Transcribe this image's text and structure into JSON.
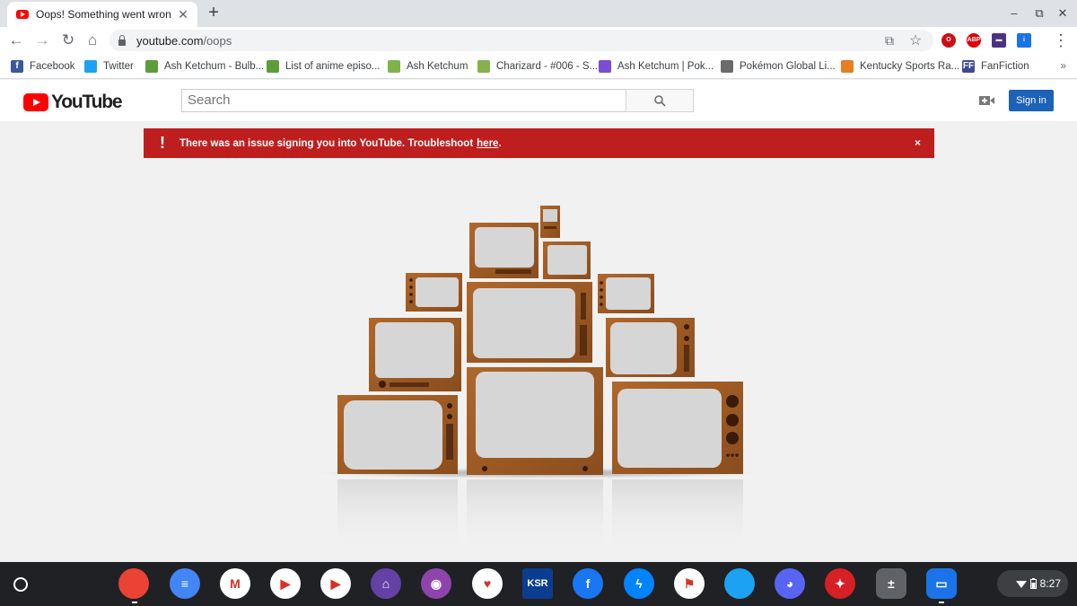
{
  "browser": {
    "tab": {
      "title": "Oops! Something went wrong. - YouTube",
      "close_glyph": "✕"
    },
    "new_tab_glyph": "+",
    "window_controls": {
      "minimize": "–",
      "restore": "⧉",
      "close": "✕"
    },
    "nav": {
      "back": "←",
      "forward": "→",
      "reload": "↻",
      "home": "⌂"
    },
    "address": {
      "host": "youtube.com",
      "path": "/oops"
    },
    "omnibox_icons": {
      "share": "⧉",
      "star": "☆"
    },
    "extensions": [
      {
        "name": "opera-icon",
        "label": "O",
        "color": "#cc0f16"
      },
      {
        "name": "adblock-icon",
        "label": "ABP",
        "color": "#e40000"
      },
      {
        "name": "twitch-ext-icon",
        "label": "▬",
        "color": "#4b3287"
      },
      {
        "name": "info-ext-icon",
        "label": "i",
        "color": "#1a73e8"
      }
    ],
    "menu_glyph": "⋮"
  },
  "bookmarks": [
    {
      "label": "Facebook",
      "icon": "facebook-icon",
      "color": "#3b5998",
      "glyph": "f"
    },
    {
      "label": "Twitter",
      "icon": "twitter-icon",
      "color": "#1da1f2",
      "glyph": ""
    },
    {
      "label": "Ash Ketchum - Bulb...",
      "icon": "bulbapedia-icon",
      "color": "#5c9d3a",
      "glyph": ""
    },
    {
      "label": "List of anime episo...",
      "icon": "bulbapedia-icon",
      "color": "#5c9d3a",
      "glyph": ""
    },
    {
      "label": "Ash Ketchum",
      "icon": "fandom-icon",
      "color": "#7eb34a",
      "glyph": ""
    },
    {
      "label": "Charizard - #006 - S...",
      "icon": "serebii-icon",
      "color": "#84b04e",
      "glyph": ""
    },
    {
      "label": "Ash Ketchum | Pok...",
      "icon": "pokemon-wiki-icon",
      "color": "#7a4dd1",
      "glyph": ""
    },
    {
      "label": "Pokémon Global Li...",
      "icon": "pokeball-icon",
      "color": "#6b6b6b",
      "glyph": ""
    },
    {
      "label": "Kentucky Sports Ra...",
      "icon": "ksr-icon",
      "color": "#e67e22",
      "glyph": ""
    },
    {
      "label": "FanFiction",
      "icon": "fanfiction-icon",
      "color": "#3a4b8f",
      "glyph": "FF"
    }
  ],
  "bookmarks_more": "»",
  "youtube": {
    "logo_text": "YouTube",
    "search_placeholder": "Search",
    "signin_label": "Sign in"
  },
  "alert": {
    "text": "There was an issue signing you into YouTube. Troubleshoot",
    "link": "here",
    "suffix": ".",
    "icon": "!",
    "close": "×",
    "color": "#be1e1e"
  },
  "shelf": {
    "apps": [
      {
        "name": "chrome-app",
        "glyph": "",
        "color": "#ea4335"
      },
      {
        "name": "docs-app",
        "glyph": "≡",
        "color": "#4285f4"
      },
      {
        "name": "gmail-app",
        "glyph": "M",
        "color": "#ffffff"
      },
      {
        "name": "play-store-app",
        "glyph": "▶",
        "color": "#ffffff"
      },
      {
        "name": "youtube-app",
        "glyph": "▶",
        "color": "#ffffff"
      },
      {
        "name": "twitch-app",
        "glyph": "⌂",
        "color": "#6441a5"
      },
      {
        "name": "podcasts-app",
        "glyph": "◉",
        "color": "#8e44ad"
      },
      {
        "name": "iheartradio-app",
        "glyph": "♥",
        "color": "#ffffff"
      },
      {
        "name": "ksr-app",
        "glyph": "KSR",
        "color": "#0a3d8f"
      },
      {
        "name": "facebook-app",
        "glyph": "f",
        "color": "#1877f2"
      },
      {
        "name": "messenger-app",
        "glyph": "ϟ",
        "color": "#0084ff"
      },
      {
        "name": "flag-app",
        "glyph": "⚑",
        "color": "#ffffff"
      },
      {
        "name": "twitter-app",
        "glyph": "",
        "color": "#1da1f2"
      },
      {
        "name": "discord-app",
        "glyph": "◕",
        "color": "#5865f2"
      },
      {
        "name": "disney-app",
        "glyph": "✦",
        "color": "#d71f26"
      },
      {
        "name": "calculator-app",
        "glyph": "±",
        "color": "#5f6368"
      },
      {
        "name": "files-app",
        "glyph": "▭",
        "color": "#1a73e8"
      }
    ],
    "clock": "8:27"
  }
}
